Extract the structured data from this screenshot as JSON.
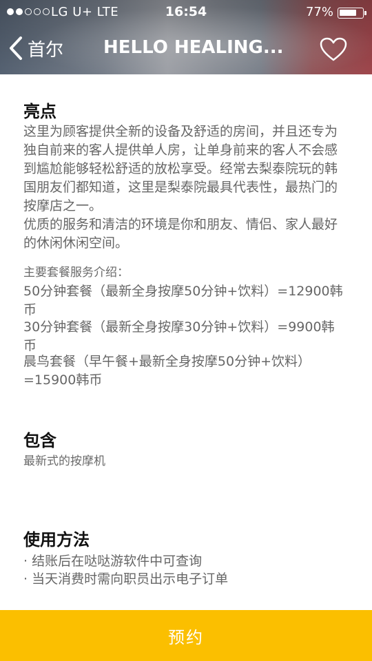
{
  "status_bar": {
    "carrier": "LG U+   LTE",
    "time": "16:54",
    "battery_text": "77%",
    "battery_level": 0.77
  },
  "nav": {
    "back_label": "首尔",
    "title": "HELLO HEALING...",
    "back_icon": "chevron-left-icon",
    "favorite_icon": "heart-outline-icon"
  },
  "highlights": {
    "title": "亮点",
    "description": "这里为顾客提供全新的设备及舒适的房间，并且还专为独自前来的客人提供单人房，让单身前来的客人不会感到尴尬能够轻松舒适的放松享受。经常去梨泰院玩的韩国朋友们都知道，这里是梨泰院最具代表性，最热门的按摩店之一。\n优质的服务和清洁的环境是你和朋友、情侣、家人最好的休闲休闲空间。",
    "packages_intro": "主要套餐服务介绍：",
    "packages": [
      "50分钟套餐（最新全身按摩50分钟+饮料）=12900韩币",
      "30分钟套餐（最新全身按摩30分钟+饮料）=9900韩币",
      "晨鸟套餐（早午餐+最新全身按摩50分钟+饮料）=15900韩币"
    ]
  },
  "includes": {
    "title": "包含",
    "text": "最新式的按摩机"
  },
  "usage": {
    "title": "使用方法",
    "items": [
      "· 结账后在哒哒游软件中可查询",
      "· 当天消费时需向职员出示电子订单"
    ]
  },
  "footer": {
    "book_label": "预约",
    "accent_color": "#fbbf00"
  }
}
